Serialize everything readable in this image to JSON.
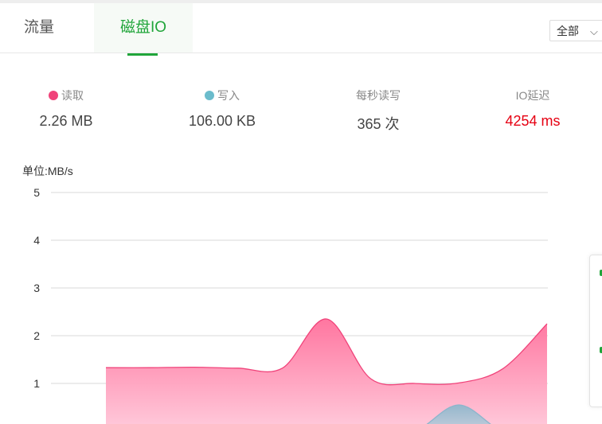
{
  "tabs": [
    {
      "label": "流量",
      "active": false
    },
    {
      "label": "磁盘IO",
      "active": true
    }
  ],
  "select": {
    "value": "全部"
  },
  "stats": {
    "read": {
      "label": "读取",
      "value": "2.26 MB",
      "color": "#f0437a"
    },
    "write": {
      "label": "写入",
      "value": "106.00 KB",
      "color": "#6bbccc"
    },
    "ops": {
      "label": "每秒读写",
      "value": "365 次"
    },
    "latency": {
      "label": "IO延迟",
      "value": "4254 ms",
      "color": "#e60012"
    }
  },
  "chart_data": {
    "type": "area",
    "ylabel": "单位:MB/s",
    "yticks": [
      "5",
      "4",
      "3",
      "2",
      "1"
    ],
    "ylim": [
      0,
      5
    ],
    "x": [
      0,
      1,
      2,
      3,
      4,
      5,
      6,
      7,
      8,
      9,
      10
    ],
    "series": [
      {
        "name": "读取",
        "color": "#f0437a",
        "values": [
          1.33,
          1.33,
          1.34,
          1.32,
          1.32,
          2.35,
          1.1,
          1.0,
          1.01,
          1.31,
          2.25
        ]
      },
      {
        "name": "写入",
        "color": "#8cb5cc",
        "values": [
          0,
          0,
          0,
          0,
          0,
          0,
          0,
          0,
          0.55,
          0,
          0
        ]
      }
    ],
    "grid": true
  }
}
